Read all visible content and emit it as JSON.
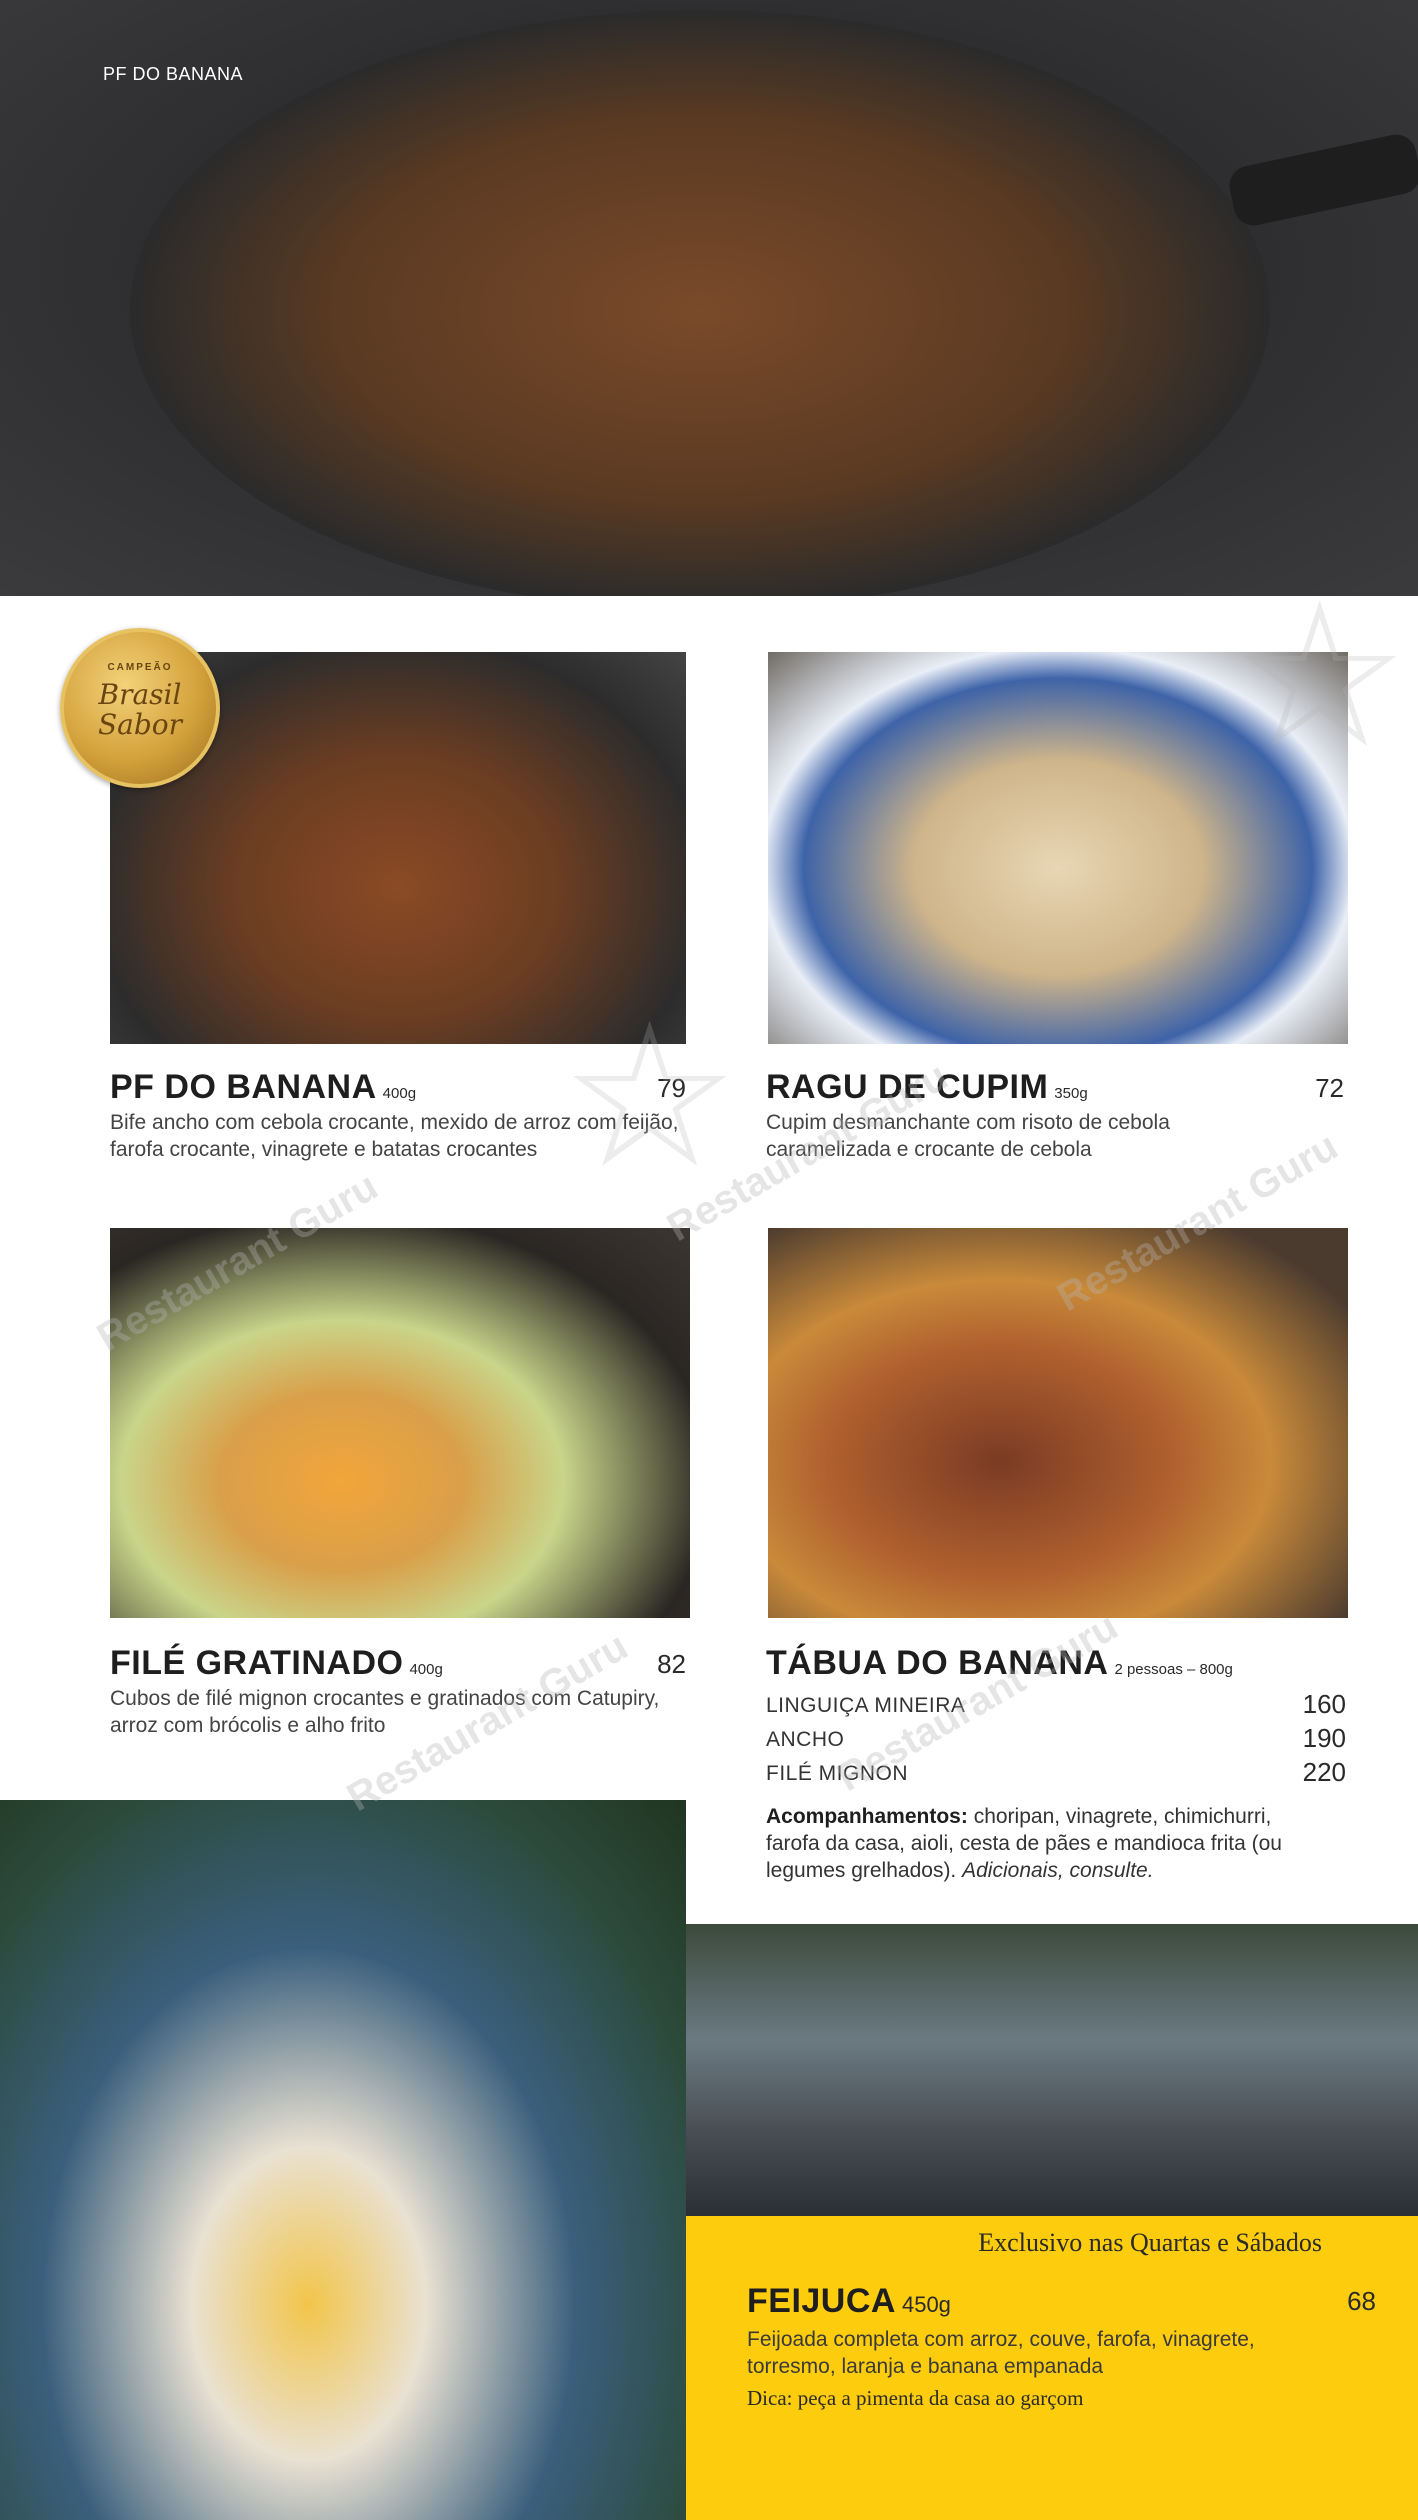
{
  "hero": {
    "label": "PF DO BANANA"
  },
  "seal": {
    "top": "CAMPEÃO",
    "line1": "Brasil",
    "line2": "Sabor"
  },
  "dishes": {
    "pf": {
      "name": "PF DO BANANA",
      "weight": "400g",
      "price": "79",
      "description": "Bife ancho com cebola crocante, mexido de arroz com feijão, farofa crocante, vinagrete e batatas crocantes"
    },
    "ragu": {
      "name": "RAGU DE CUPIM",
      "weight": "350g",
      "price": "72",
      "description": "Cupim desmanchante com risoto de cebola caramelizada e crocante de cebola"
    },
    "file": {
      "name": "FILÉ GRATINADO",
      "weight": "400g",
      "price": "82",
      "description": "Cubos de filé mignon crocantes e gratinados com Catupiry, arroz com brócolis e alho frito"
    },
    "tabua": {
      "name": "TÁBUA DO BANANA",
      "weight": "2 pessoas – 800g",
      "options": [
        {
          "label": "LINGUIÇA MINEIRA",
          "price": "160"
        },
        {
          "label": "ANCHO",
          "price": "190"
        },
        {
          "label": "FILÉ MIGNON",
          "price": "220"
        }
      ],
      "accompaniments_label": "Acompanhamentos:",
      "accompaniments_text": "choripan, vinagrete, chimichurri, farofa da casa, aioli, cesta de pães e mandioca frita (ou legumes grelhados).",
      "additional": "Adicionais, consulte."
    },
    "feijuca": {
      "exclusive": "Exclusivo nas Quartas e Sábados",
      "name": "FEIJUCA",
      "weight": "450g",
      "price": "68",
      "description": "Feijoada completa com arroz, couve, farofa, vinagrete, torresmo, laranja e banana empanada",
      "tip": "Dica: peça a pimenta da casa ao garçom"
    }
  },
  "watermark": "Restaurant Guru"
}
